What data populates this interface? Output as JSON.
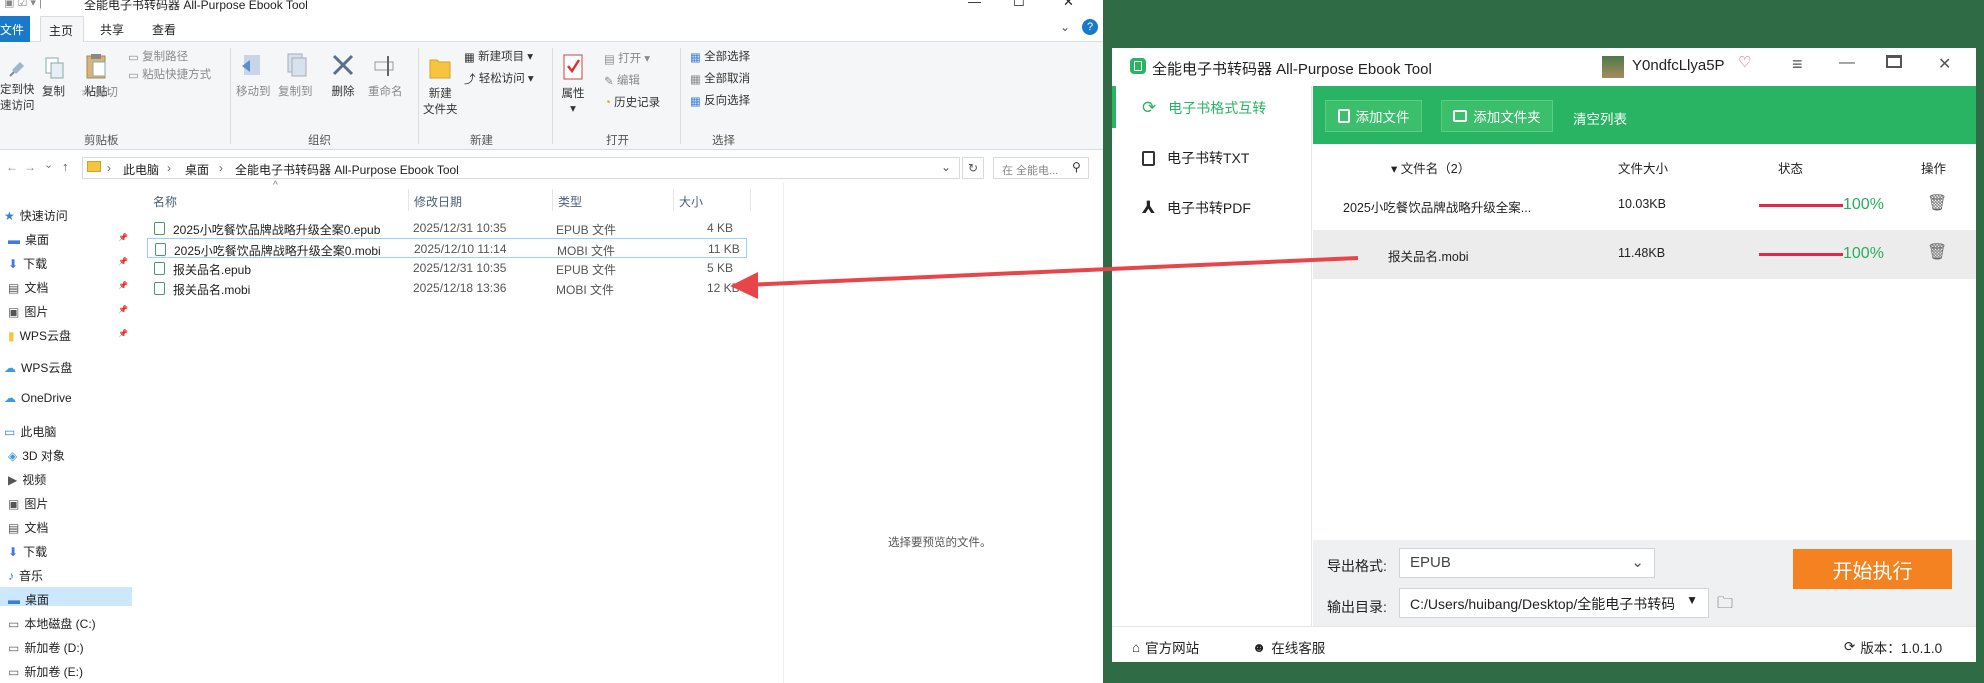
{
  "explorer": {
    "title": "全能电子书转码器 All-Purpose Ebook Tool",
    "tabs": [
      "文件",
      "主页",
      "共享",
      "查看"
    ],
    "ribbon": {
      "pin_label": [
        "定到快",
        "速访问"
      ],
      "copy": "复制",
      "paste": "粘贴",
      "copy_path": "复制路径",
      "paste_shortcut": "粘贴快捷方式",
      "cut": "剪切",
      "clipboard_group": "剪贴板",
      "move_to": "移动到",
      "copy_to": "复制到",
      "delete": "删除",
      "rename": "重命名",
      "organize_group": "组织",
      "new_folder": [
        "新建",
        "文件夹"
      ],
      "new_item": "新建项目",
      "easy_access": "轻松访问",
      "new_group": "新建",
      "properties": "属性",
      "open": "打开",
      "edit": "编辑",
      "history": "历史记录",
      "open_group": "打开",
      "select_all": "全部选择",
      "select_none": "全部取消",
      "invert_select": "反向选择",
      "select_group": "选择"
    },
    "breadcrumb": [
      "此电脑",
      "桌面",
      "全能电子书转码器 All-Purpose Ebook Tool"
    ],
    "search_placeholder": "在 全能电...",
    "nav": [
      {
        "label": "快速访问",
        "icon": "star-icon"
      },
      {
        "label": "桌面",
        "icon": "desktop-icon",
        "pin": true
      },
      {
        "label": "下载",
        "icon": "download-icon",
        "pin": true
      },
      {
        "label": "文档",
        "icon": "document-icon",
        "pin": true
      },
      {
        "label": "图片",
        "icon": "picture-icon",
        "pin": true
      },
      {
        "label": "WPS云盘",
        "icon": "folder-icon",
        "pin": true
      },
      {
        "label": "WPS云盘",
        "icon": "cloud-icon"
      },
      {
        "label": "OneDrive",
        "icon": "cloud-icon"
      },
      {
        "label": "此电脑",
        "icon": "computer-icon"
      },
      {
        "label": "3D 对象",
        "icon": "cube-icon"
      },
      {
        "label": "视频",
        "icon": "video-icon"
      },
      {
        "label": "图片",
        "icon": "picture-icon"
      },
      {
        "label": "文档",
        "icon": "document-icon"
      },
      {
        "label": "下载",
        "icon": "download-icon"
      },
      {
        "label": "音乐",
        "icon": "music-icon"
      },
      {
        "label": "桌面",
        "icon": "desktop-icon",
        "selected": true
      },
      {
        "label": "本地磁盘 (C:)",
        "icon": "drive-icon"
      },
      {
        "label": "新加卷 (D:)",
        "icon": "drive-icon"
      },
      {
        "label": "新加卷 (E:)",
        "icon": "drive-icon"
      }
    ],
    "columns": [
      "名称",
      "修改日期",
      "类型",
      "大小"
    ],
    "files": [
      {
        "name": "2025小吃餐饮品牌战略升级全案0.epub",
        "date": "2025/12/31 10:35",
        "type": "EPUB 文件",
        "size": "4 KB"
      },
      {
        "name": "2025小吃餐饮品牌战略升级全案0.mobi",
        "date": "2025/12/10 11:14",
        "type": "MOBI 文件",
        "size": "11 KB"
      },
      {
        "name": "报关品名.epub",
        "date": "2025/12/31 10:35",
        "type": "EPUB 文件",
        "size": "5 KB"
      },
      {
        "name": "报关品名.mobi",
        "date": "2025/12/18 13:36",
        "type": "MOBI 文件",
        "size": "12 KB"
      }
    ],
    "preview_text": "选择要预览的文件。"
  },
  "app": {
    "title": "全能电子书转码器 All-Purpose Ebook Tool",
    "username": "Y0ndfcLlya5P",
    "sidebar": [
      "电子书格式互转",
      "电子书转TXT",
      "电子书转PDF"
    ],
    "buttons": {
      "add_file": "添加文件",
      "add_folder": "添加文件夹",
      "clear": "清空列表"
    },
    "columns": {
      "name": "文件名（2）",
      "size": "文件大小",
      "status": "状态",
      "action": "操作"
    },
    "rows": [
      {
        "name": "2025小吃餐饮品牌战略升级全案...",
        "size": "10.03KB",
        "progress": 100,
        "pct": "100%"
      },
      {
        "name": "报关品名.mobi",
        "size": "11.48KB",
        "progress": 100,
        "pct": "100%"
      }
    ],
    "export_format_label": "导出格式:",
    "export_format": "EPUB",
    "output_dir_label": "输出目录:",
    "output_dir": "C:/Users/huibang/Desktop/全能电子书转码器 All-Pu",
    "exec_button": "开始执行",
    "footer": {
      "website": "官方网站",
      "service": "在线客服",
      "version": "版本：1.0.1.0"
    },
    "colors": {
      "green": "#28b463",
      "orange": "#f58220",
      "progress": "#e2264f",
      "pct": "#27ae60"
    }
  }
}
